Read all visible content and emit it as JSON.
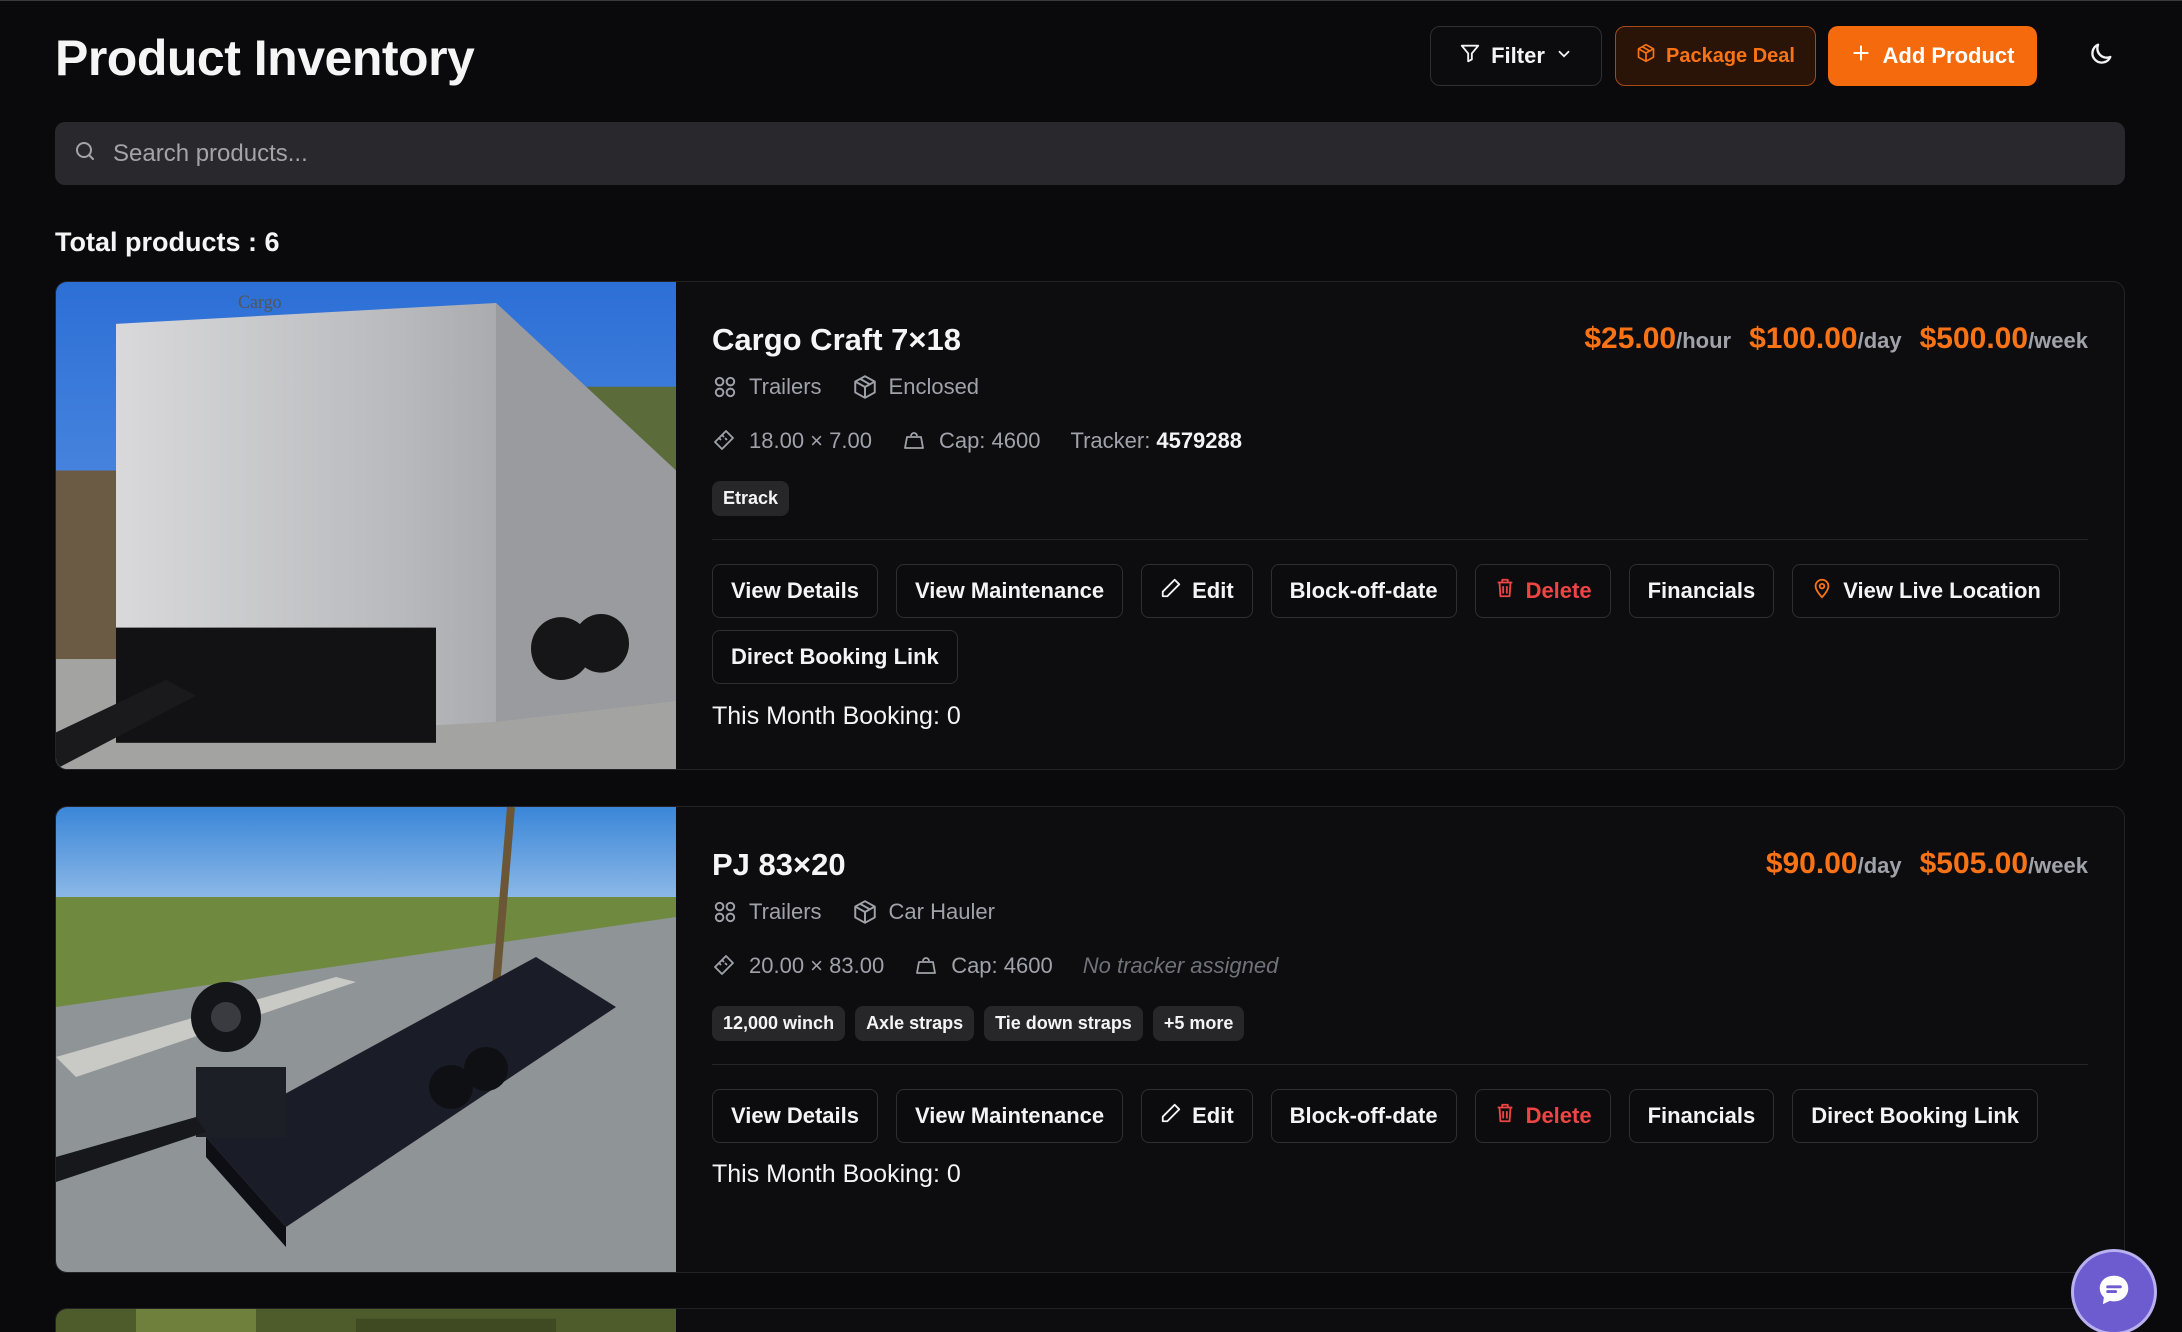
{
  "header": {
    "title": "Product Inventory",
    "filter_label": "Filter",
    "package_label": "Package Deal",
    "add_label": "Add Product"
  },
  "search": {
    "placeholder": "Search products..."
  },
  "summary": {
    "total_text": "Total products : 6"
  },
  "products": [
    {
      "name": "Cargo Craft 7×18",
      "category": "Trailers",
      "subtype": "Enclosed",
      "dimensions": "18.00 × 7.00",
      "capacity": "Cap: 4600",
      "tracker_label": "Tracker:",
      "tracker_value": "4579288",
      "prices": [
        {
          "amount": "$25.00",
          "unit": "/hour"
        },
        {
          "amount": "$100.00",
          "unit": "/day"
        },
        {
          "amount": "$500.00",
          "unit": "/week"
        }
      ],
      "tags": [
        "Etrack"
      ],
      "actions": [
        "View Details",
        "View Maintenance",
        "Edit",
        "Block-off-date",
        "Delete",
        "Financials",
        "View Live Location",
        "Direct Booking Link"
      ],
      "booking_text": "This Month Booking: 0"
    },
    {
      "name": "PJ 83×20",
      "category": "Trailers",
      "subtype": "Car Hauler",
      "dimensions": "20.00 × 83.00",
      "capacity": "Cap: 4600",
      "tracker_note": "No tracker assigned",
      "prices": [
        {
          "amount": "$90.00",
          "unit": "/day"
        },
        {
          "amount": "$505.00",
          "unit": "/week"
        }
      ],
      "tags": [
        "12,000 winch",
        "Axle straps",
        "Tie down straps",
        "+5 more"
      ],
      "actions": [
        "View Details",
        "View Maintenance",
        "Edit",
        "Block-off-date",
        "Delete",
        "Financials",
        "Direct Booking Link"
      ],
      "booking_text": "This Month Booking: 0"
    }
  ],
  "colors": {
    "accent": "#f56a0c",
    "price": "#f97316",
    "danger": "#ef4444",
    "background": "#0a0a0c",
    "chat": "#6d5bd0"
  },
  "icons": [
    "filter-icon",
    "chevron-down-icon",
    "package-icon",
    "plus-icon",
    "moon-icon",
    "search-icon",
    "grid-icon",
    "box-icon",
    "ruler-icon",
    "weight-icon",
    "pencil-icon",
    "trash-icon",
    "map-pin-icon",
    "chat-icon"
  ]
}
